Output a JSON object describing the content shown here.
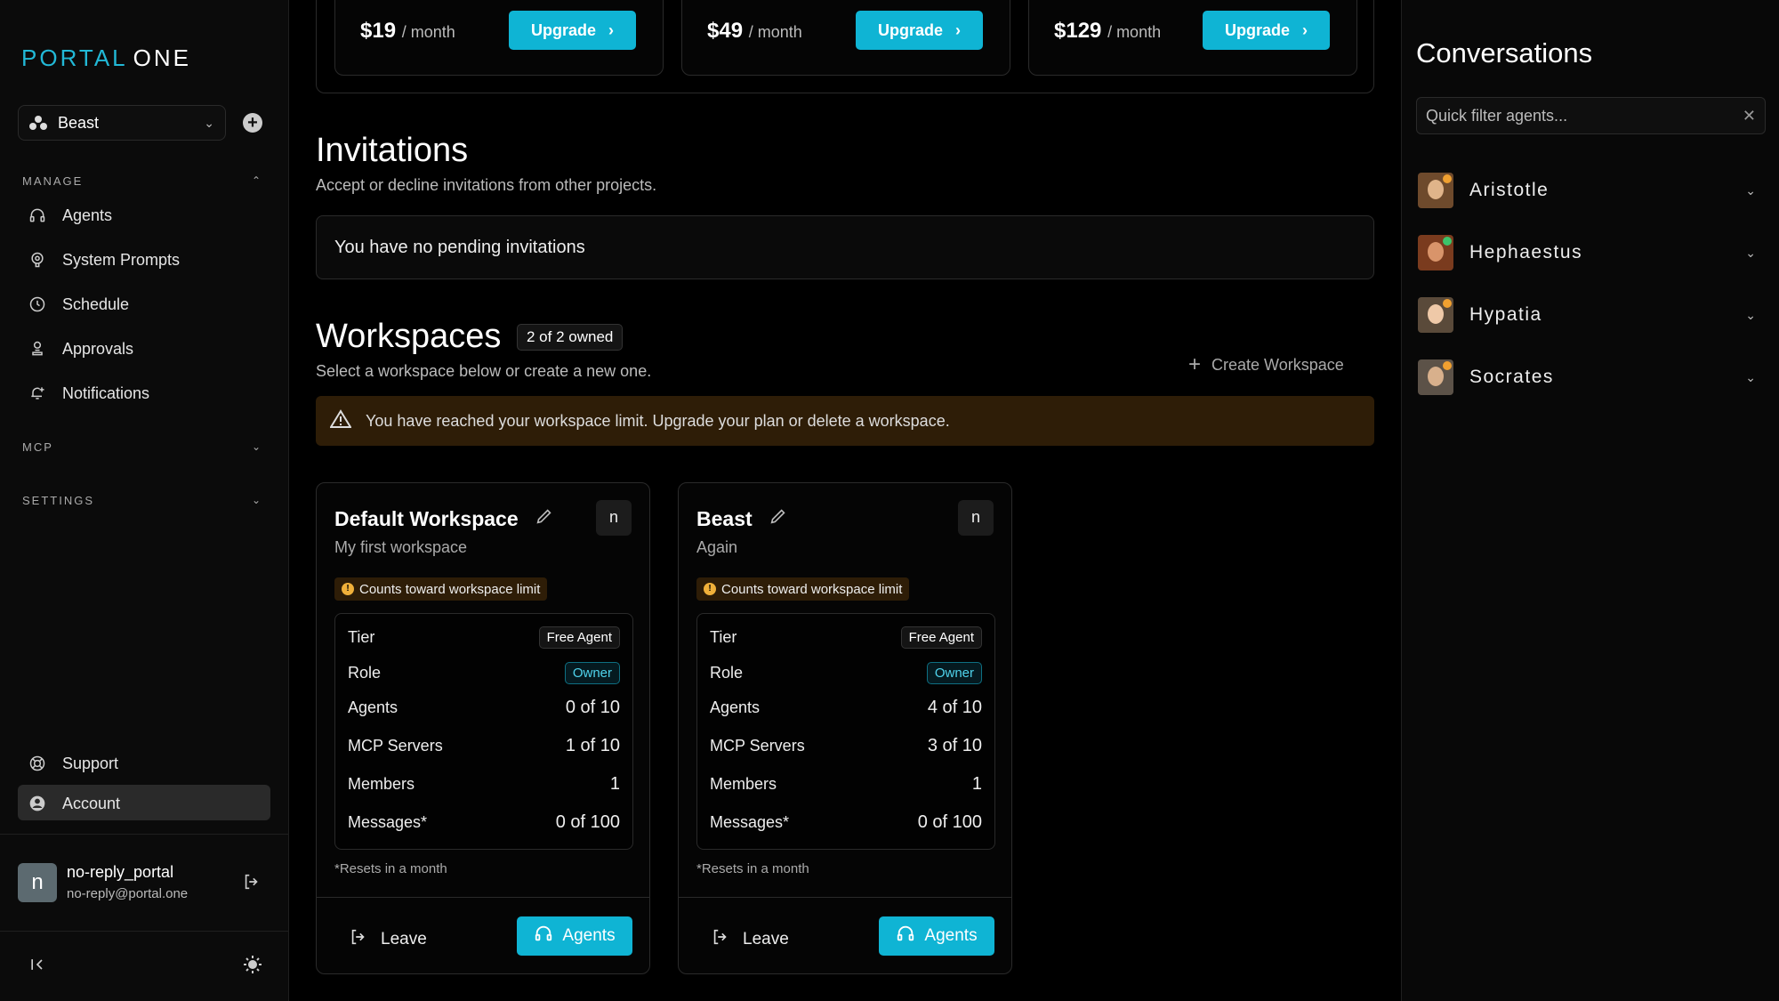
{
  "brand": {
    "part1": "PORTAL",
    "part2": "ONE"
  },
  "sidebar": {
    "workspace_selector": "Beast",
    "manage_label": "MANAGE",
    "manage_items": [
      {
        "label": "Agents",
        "icon": "headset-icon"
      },
      {
        "label": "System Prompts",
        "icon": "brain-icon"
      },
      {
        "label": "Schedule",
        "icon": "clock-icon"
      },
      {
        "label": "Approvals",
        "icon": "person-stamp-icon"
      },
      {
        "label": "Notifications",
        "icon": "bell-plus-icon"
      }
    ],
    "mcp_label": "MCP",
    "settings_label": "SETTINGS",
    "support": "Support",
    "account": "Account",
    "user": {
      "initial": "n",
      "name": "no-reply_portal",
      "email": "no-reply@portal.one"
    }
  },
  "plans": [
    {
      "price": "$19",
      "period": "/ month",
      "button": "Upgrade"
    },
    {
      "price": "$49",
      "period": "/ month",
      "button": "Upgrade"
    },
    {
      "price": "$129",
      "period": "/ month",
      "button": "Upgrade"
    }
  ],
  "invitations": {
    "title": "Invitations",
    "subtitle": "Accept or decline invitations from other projects.",
    "empty": "You have no pending invitations"
  },
  "workspaces": {
    "title": "Workspaces",
    "owned_badge": "2 of 2 owned",
    "subtitle": "Select a workspace below or create a new one.",
    "create_label": "Create Workspace",
    "warning": "You have reached your workspace limit. Upgrade your plan or delete a workspace.",
    "cards": [
      {
        "name": "Default Workspace",
        "desc": "My first workspace",
        "badge": "n",
        "limit_note": "Counts toward workspace limit",
        "tier_label": "Tier",
        "tier": "Free Agent",
        "role_label": "Role",
        "role": "Owner",
        "agents_label": "Agents",
        "agents": "0 of 10",
        "mcp_label": "MCP Servers",
        "mcp": "1 of 10",
        "members_label": "Members",
        "members": "1",
        "messages_label": "Messages*",
        "messages": "0 of 100",
        "reset": "*Resets in a month",
        "leave": "Leave",
        "agents_button": "Agents"
      },
      {
        "name": "Beast",
        "desc": "Again",
        "badge": "n",
        "limit_note": "Counts toward workspace limit",
        "tier_label": "Tier",
        "tier": "Free Agent",
        "role_label": "Role",
        "role": "Owner",
        "agents_label": "Agents",
        "agents": "4 of 10",
        "mcp_label": "MCP Servers",
        "mcp": "3 of 10",
        "members_label": "Members",
        "members": "1",
        "messages_label": "Messages*",
        "messages": "0 of 100",
        "reset": "*Resets in a month",
        "leave": "Leave",
        "agents_button": "Agents"
      }
    ]
  },
  "conversations": {
    "title": "Conversations",
    "filter_placeholder": "Quick filter agents...",
    "agents": [
      {
        "name": "Aristotle",
        "status_color": "#f0a030"
      },
      {
        "name": "Hephaestus",
        "status_color": "#3cc46a"
      },
      {
        "name": "Hypatia",
        "status_color": "#f0a030"
      },
      {
        "name": "Socrates",
        "status_color": "#f0a030"
      }
    ]
  },
  "colors": {
    "accent": "#0fb4d4",
    "warning_bg": "#2e1d07"
  }
}
